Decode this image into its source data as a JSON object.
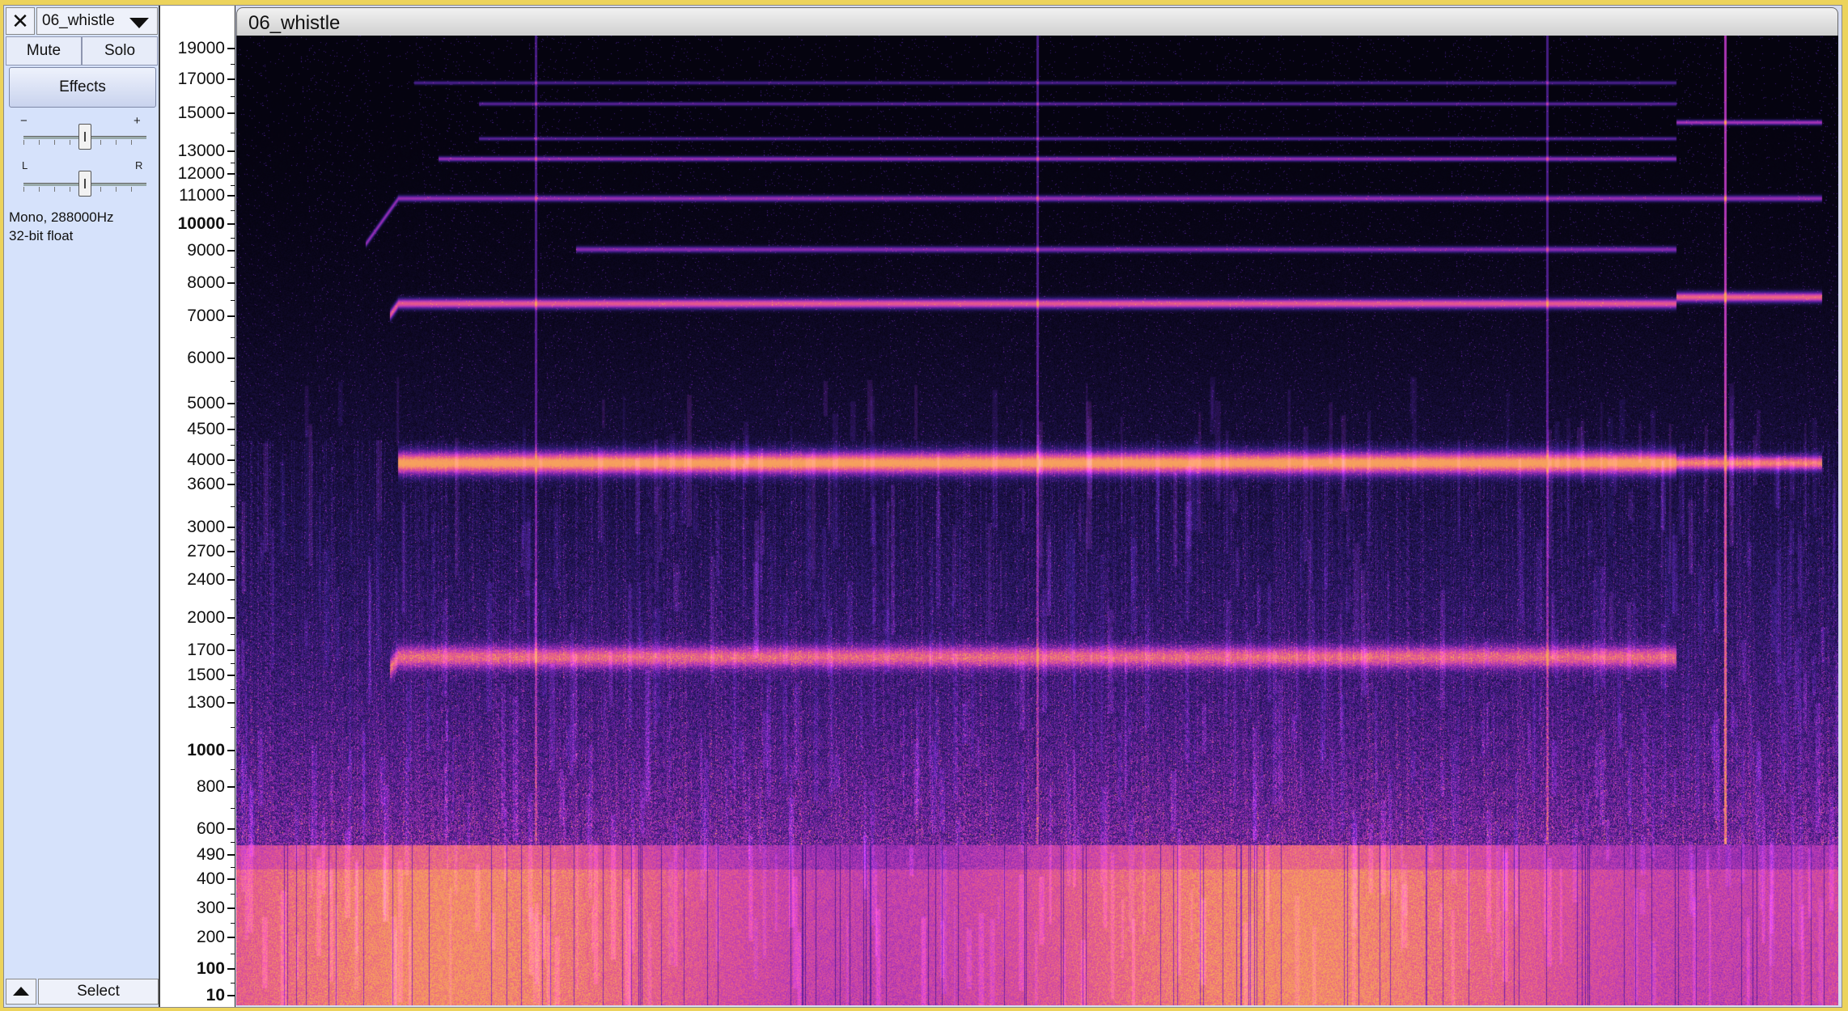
{
  "track": {
    "name": "06_whistle",
    "close_glyph": "✕",
    "mute_label": "Mute",
    "solo_label": "Solo",
    "effects_label": "Effects",
    "gain": {
      "minus": "−",
      "plus": "+",
      "value": 0.5
    },
    "pan": {
      "left": "L",
      "right": "R",
      "value": 0.5
    },
    "format_line1": "Mono, 288000Hz",
    "format_line2": "32-bit float",
    "select_label": "Select"
  },
  "spectrogram": {
    "title": "06_whistle",
    "colormap": [
      "#05030f",
      "#2c1a6e",
      "#6d22a4",
      "#b93ab8",
      "#e85a8a",
      "#f7a05d"
    ],
    "ruler_labels": [
      {
        "v": "19000",
        "major": false
      },
      {
        "v": "17000",
        "major": false
      },
      {
        "v": "15000",
        "major": false
      },
      {
        "v": "13000",
        "major": false
      },
      {
        "v": "12000",
        "major": false
      },
      {
        "v": "11000",
        "major": false
      },
      {
        "v": "10000",
        "major": true
      },
      {
        "v": "9000",
        "major": false
      },
      {
        "v": "8000",
        "major": false
      },
      {
        "v": "7000",
        "major": false
      },
      {
        "v": "6000",
        "major": false
      },
      {
        "v": "5000",
        "major": false
      },
      {
        "v": "4500",
        "major": false
      },
      {
        "v": "4000",
        "major": false
      },
      {
        "v": "3600",
        "major": false
      },
      {
        "v": "3000",
        "major": false
      },
      {
        "v": "2700",
        "major": false
      },
      {
        "v": "2400",
        "major": false
      },
      {
        "v": "2000",
        "major": false
      },
      {
        "v": "1700",
        "major": false
      },
      {
        "v": "1500",
        "major": false
      },
      {
        "v": "1300",
        "major": false
      },
      {
        "v": "1000",
        "major": true
      },
      {
        "v": "800",
        "major": false
      },
      {
        "v": "600",
        "major": false
      },
      {
        "v": "490",
        "major": false
      },
      {
        "v": "400",
        "major": false
      },
      {
        "v": "300",
        "major": false
      },
      {
        "v": "200",
        "major": false
      },
      {
        "v": "100",
        "major": true
      },
      {
        "v": "10",
        "major": true
      }
    ]
  }
}
